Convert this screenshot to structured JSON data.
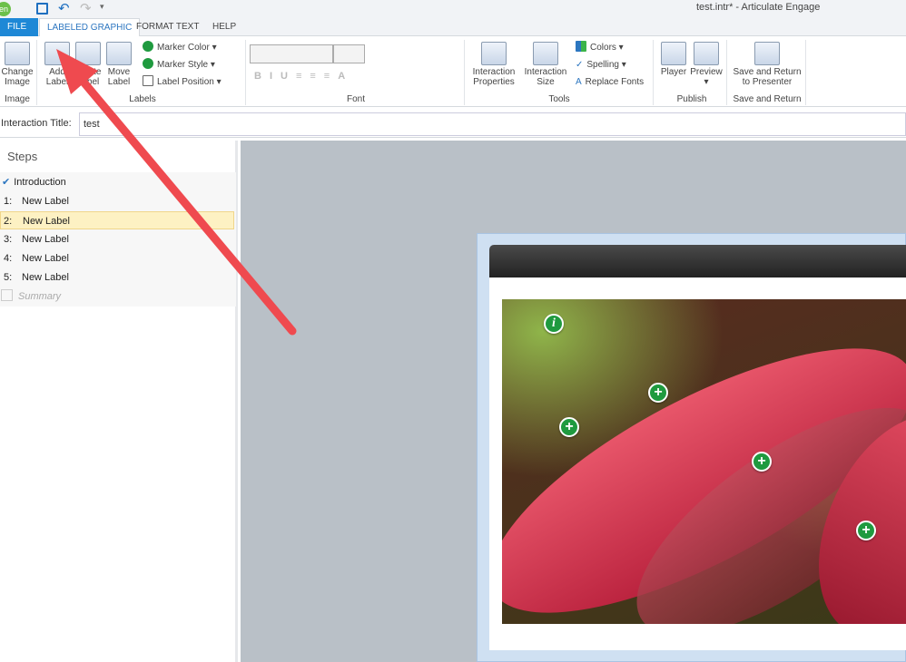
{
  "window": {
    "title": "test.intr* -  Articulate Engage",
    "app_badge": "en"
  },
  "tabs": [
    "FILE",
    "LABELED GRAPHIC",
    "FORMAT TEXT",
    "HELP"
  ],
  "ribbon": {
    "image_group": {
      "label": "Image",
      "change_image": "Change Image"
    },
    "labels_group": {
      "label": "Labels",
      "add": "Add Label",
      "delete": "Delete Label",
      "move": "Move Label",
      "marker_color": "Marker Color",
      "marker_style": "Marker Style",
      "label_position": "Label Position"
    },
    "font_group": {
      "label": "Font"
    },
    "tools_group": {
      "label": "Tools",
      "properties": "Interaction Properties",
      "size": "Interaction Size",
      "colors": "Colors",
      "spelling": "Spelling",
      "replace_fonts": "Replace Fonts"
    },
    "publish_group": {
      "label": "Publish",
      "player": "Player",
      "preview": "Preview"
    },
    "save_group": {
      "label": "Save and Return",
      "save": "Save and Return to Presenter"
    }
  },
  "interaction_title": {
    "label": "Interaction Title:",
    "value": "test"
  },
  "steps": {
    "header": "Steps",
    "items": [
      {
        "num": "",
        "label": "Introduction"
      },
      {
        "num": "1:",
        "label": "New Label"
      },
      {
        "num": "2:",
        "label": "New Label"
      },
      {
        "num": "3:",
        "label": "New Label"
      },
      {
        "num": "4:",
        "label": "New Label"
      },
      {
        "num": "5:",
        "label": "New Label"
      }
    ],
    "summary": "Summary"
  },
  "colors": {
    "accent": "#1e88d6",
    "marker": "#1f9a3f",
    "arrow": "#ef4a4f",
    "selected": "#fdf1c3"
  }
}
